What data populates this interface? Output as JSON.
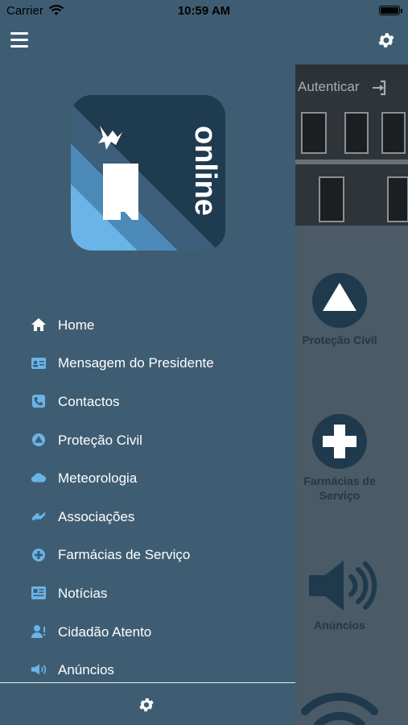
{
  "status_bar": {
    "carrier": "Carrier",
    "time": "10:59 AM"
  },
  "top_bar": {
    "menu_icon": "hamburger-icon",
    "settings_icon": "gear-icon"
  },
  "logo": {
    "text": "online",
    "icon": "bird-m-logo"
  },
  "menu": [
    {
      "label": "Home",
      "icon": "home-icon"
    },
    {
      "label": "Mensagem do Presidente",
      "icon": "id-card-icon"
    },
    {
      "label": "Contactos",
      "icon": "phone-icon"
    },
    {
      "label": "Proteção Civil",
      "icon": "civil-protection-icon"
    },
    {
      "label": "Meteorologia",
      "icon": "cloud-icon"
    },
    {
      "label": "Associações",
      "icon": "handshake-icon"
    },
    {
      "label": "Farmácias de Serviço",
      "icon": "plus-circle-icon"
    },
    {
      "label": "Notícias",
      "icon": "newspaper-icon"
    },
    {
      "label": "Cidadão Atento",
      "icon": "user-alert-icon"
    },
    {
      "label": "Anúncios",
      "icon": "megaphone-icon"
    }
  ],
  "drawer_footer": {
    "settings_icon": "gear-icon"
  },
  "background": {
    "auth_label": "Autenticar",
    "tiles": [
      {
        "label": "Proteção Civil",
        "icon": "civil-protection-icon"
      },
      {
        "label_line1": "Farmácias de",
        "label_line2": "Serviço",
        "icon": "pharmacy-cross-icon"
      },
      {
        "label": "Anúncios",
        "icon": "speaker-icon"
      },
      {
        "label": "",
        "icon": "wifi-icon"
      }
    ]
  },
  "colors": {
    "drawer_bg": "#3f5d72",
    "accent": "#1e3a4c",
    "icon_blue": "#6ab4e8"
  }
}
